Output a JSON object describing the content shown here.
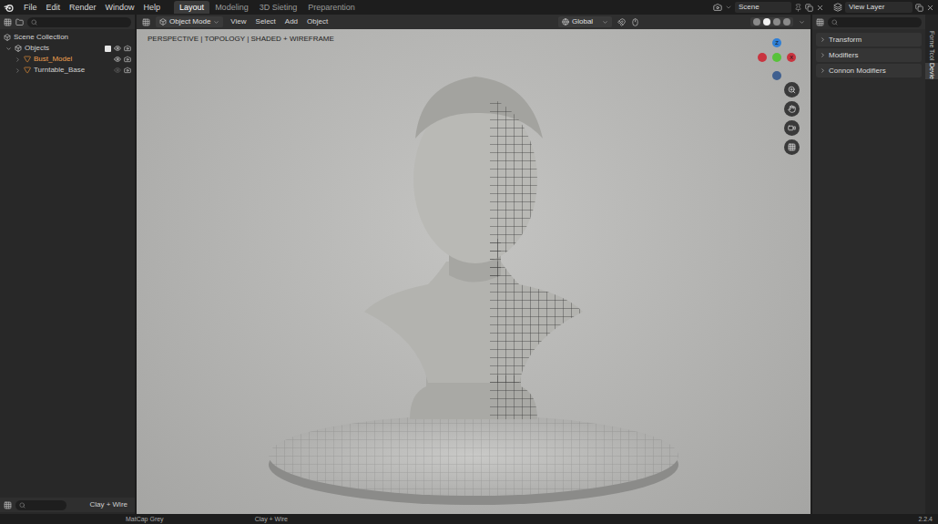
{
  "menu": [
    "File",
    "Edit",
    "Render",
    "Window",
    "Help"
  ],
  "workspaces": [
    {
      "label": "Layout",
      "selected": true
    },
    {
      "label": "Modeling",
      "selected": false
    },
    {
      "label": "3D Sieting",
      "selected": false
    },
    {
      "label": "Preparention",
      "selected": false
    }
  ],
  "scene": {
    "label": "Scene"
  },
  "view_layer": {
    "label": "View Layer"
  },
  "outliner": {
    "root": "Scene Collection",
    "items": [
      {
        "name": "Objects",
        "kind": "collection",
        "expanded": true,
        "checked": true,
        "visible": true,
        "selected": false
      },
      {
        "name": "Bust_Model",
        "kind": "mesh",
        "expanded": false,
        "visible": true,
        "selected": true
      },
      {
        "name": "Turntable_Base",
        "kind": "mesh",
        "expanded": false,
        "visible": false,
        "selected": false
      }
    ],
    "footer": "Clay + Wire"
  },
  "viewport": {
    "mode": "Object Mode",
    "menu": [
      "View",
      "Select",
      "Add",
      "Object"
    ],
    "orientation": "Global",
    "overlay_text": "PERSPECTIVE | TOPOLOGY | SHADED + WIREFRAME",
    "gizmo": [
      {
        "label": "Z",
        "color": "#2f7fd6"
      },
      {
        "label": "",
        "color": "#c9343f"
      },
      {
        "label": "",
        "color": "#57c23a"
      },
      {
        "label": "X",
        "color": "#c9343f"
      },
      {
        "label": "",
        "color": "#3f5f8f"
      }
    ],
    "shading_modes": [
      {
        "selected": false
      },
      {
        "selected": true
      },
      {
        "selected": false
      },
      {
        "selected": false
      }
    ]
  },
  "properties": {
    "panels": [
      {
        "label": "Transform",
        "expanded": false
      },
      {
        "label": "Modifiers",
        "expanded": false
      },
      {
        "label": "Connon Modifiers",
        "expanded": false
      }
    ],
    "tabs": [
      {
        "label": "Forne",
        "selected": false
      },
      {
        "label": "Tcol",
        "selected": false
      },
      {
        "label": "Devie",
        "selected": true
      }
    ]
  },
  "status_bar": {
    "items": [
      "MatCap Grey",
      "Clay + Wire"
    ],
    "version": "2.2.4"
  }
}
